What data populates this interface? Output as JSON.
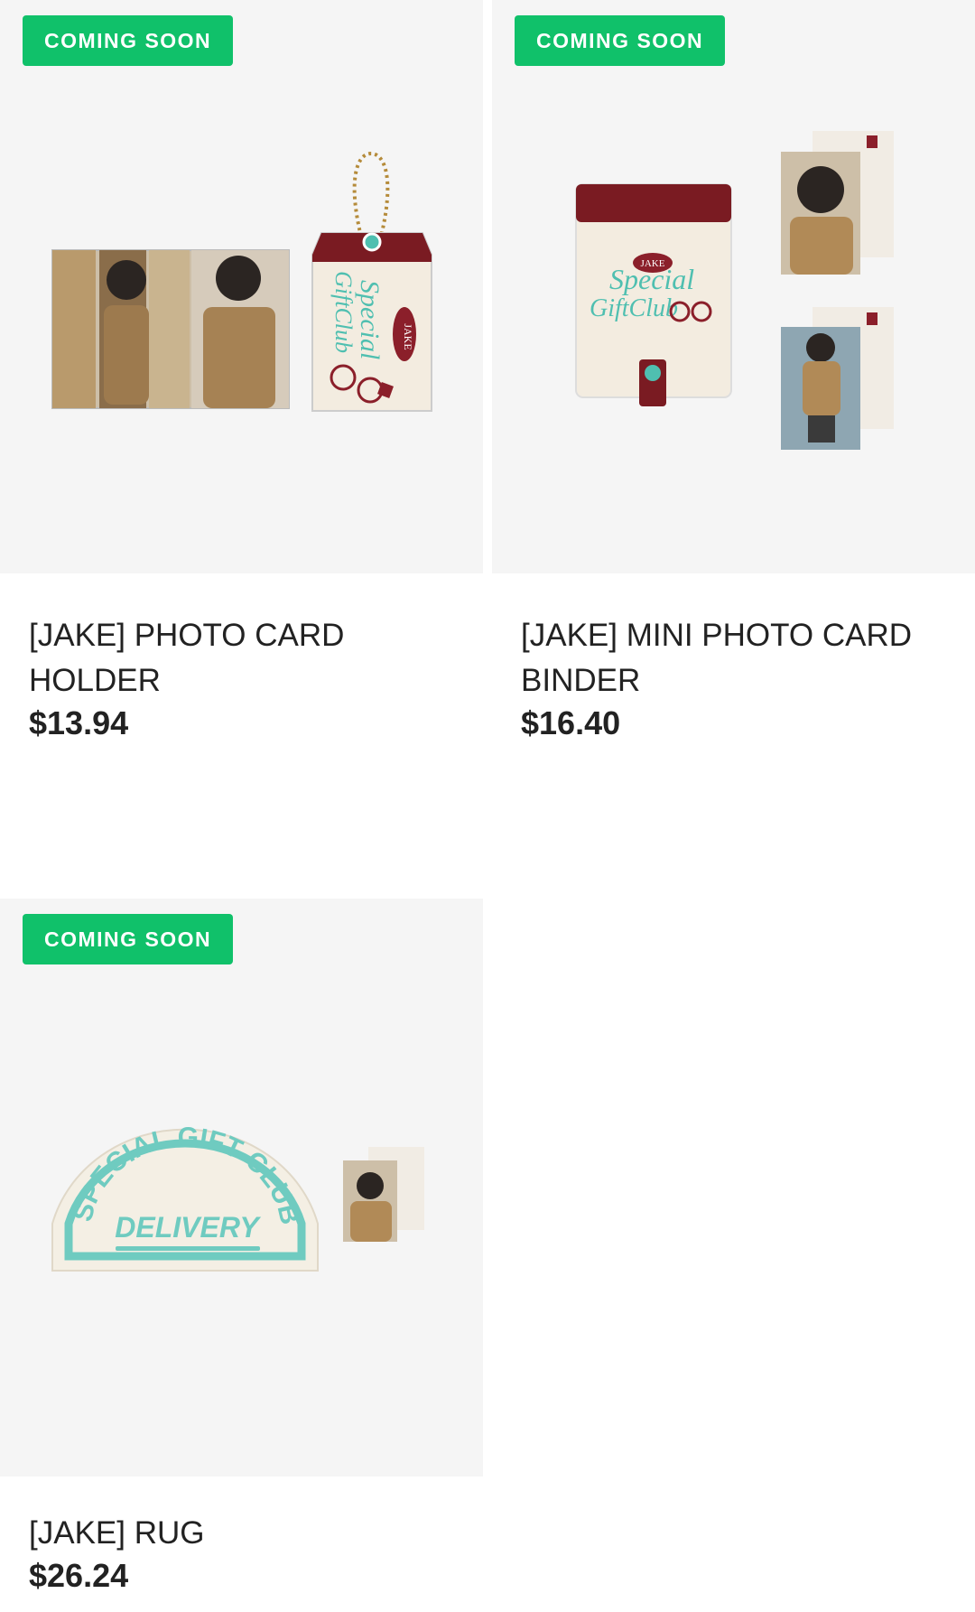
{
  "products": [
    {
      "badge": "COMING SOON",
      "title": "[JAKE] PHOTO CARD HOLDER",
      "price": "$13.94",
      "image_texts": {
        "jake": "JAKE",
        "brand1": "Special",
        "brand2": "GiftClub"
      }
    },
    {
      "badge": "COMING SOON",
      "title": "[JAKE] MINI PHOTO CARD BINDER",
      "price": "$16.40",
      "image_texts": {
        "jake": "JAKE",
        "brand1": "Special",
        "brand2": "GiftClub"
      }
    },
    {
      "badge": "COMING SOON",
      "title": "[JAKE] RUG",
      "price": "$26.24",
      "image_texts": {
        "arc": "SPECIAL GIFT CLUB",
        "delivery": "DELIVERY"
      }
    }
  ],
  "colors": {
    "badge": "#10c16a",
    "image_bg": "#f5f5f5",
    "maroon": "#7a1b22",
    "mint": "#4fbfb0"
  }
}
